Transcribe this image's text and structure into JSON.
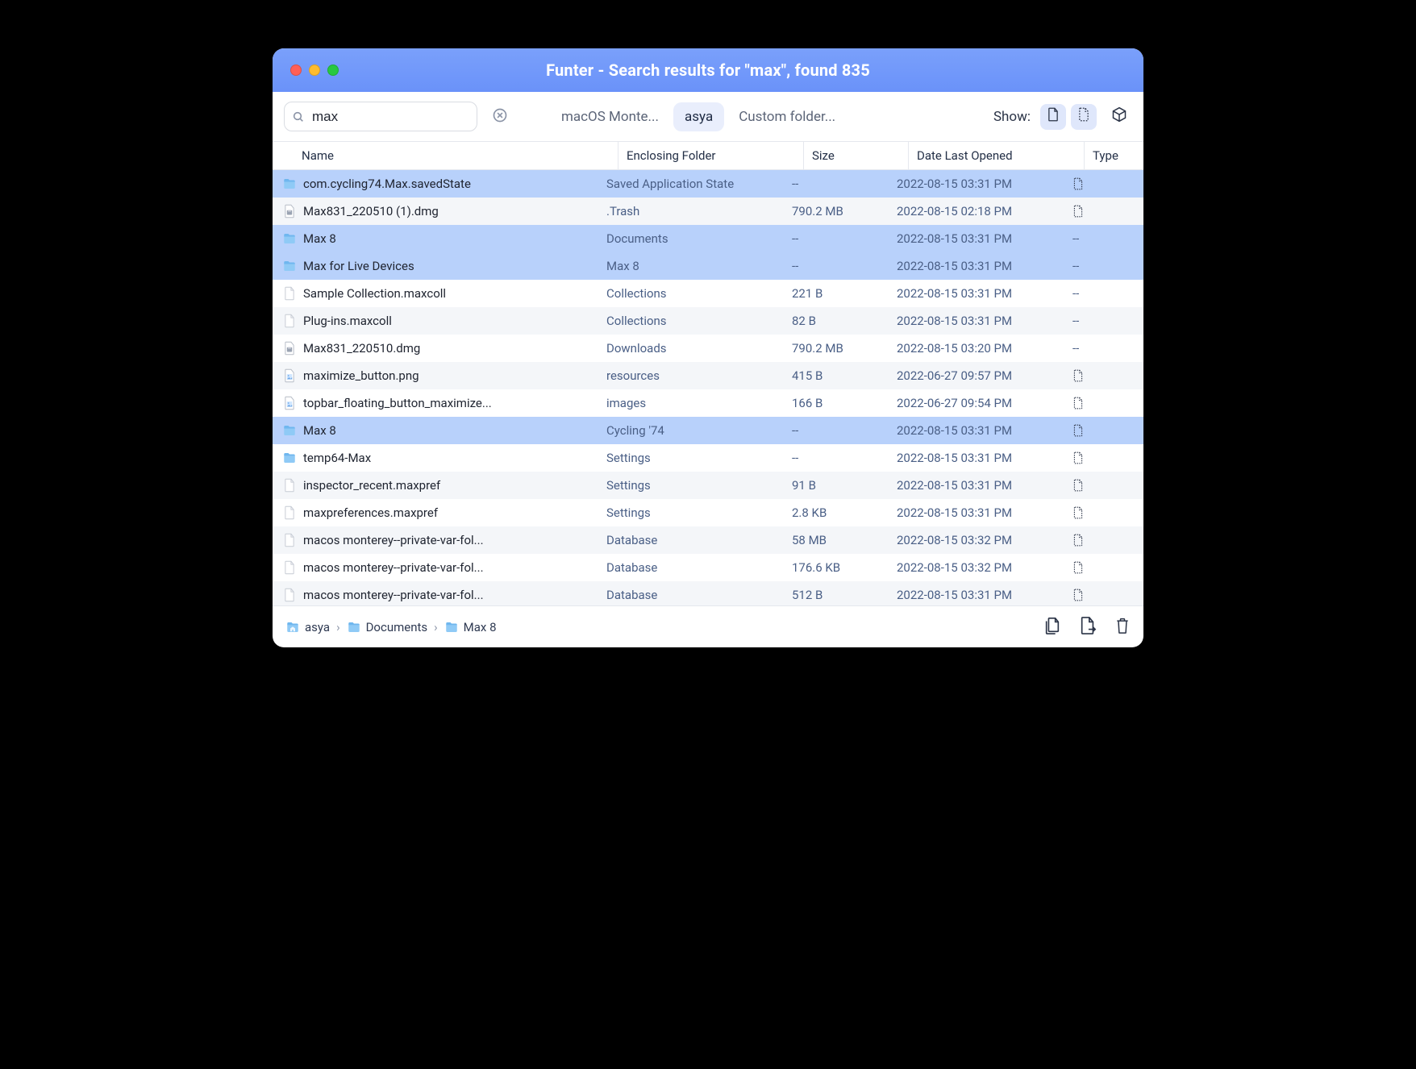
{
  "window": {
    "title": "Funter - Search results for \"max\", found 835"
  },
  "search": {
    "value": "max"
  },
  "scopes": {
    "items": [
      {
        "label": "macOS Monte...",
        "active": false
      },
      {
        "label": "asya",
        "active": true
      },
      {
        "label": "Custom folder...",
        "active": false
      }
    ]
  },
  "show": {
    "label": "Show:",
    "visible_files_on": true,
    "hidden_files_on": true
  },
  "columns": {
    "name": "Name",
    "folder": "Enclosing Folder",
    "size": "Size",
    "date": "Date Last Opened",
    "type": "Type"
  },
  "rows": [
    {
      "icon": "folder",
      "name": "com.cycling74.Max.savedState",
      "folder": "Saved Application State",
      "size": "--",
      "date": "2022-08-15 03:31 PM",
      "type": "hidden",
      "selected": true
    },
    {
      "icon": "dmg",
      "name": "Max831_220510 (1).dmg",
      "folder": ".Trash",
      "size": "790.2 MB",
      "date": "2022-08-15 02:18 PM",
      "type": "hidden",
      "selected": false
    },
    {
      "icon": "folder",
      "name": "Max 8",
      "folder": "Documents",
      "size": "--",
      "date": "2022-08-15 03:31 PM",
      "type": "--",
      "selected": true
    },
    {
      "icon": "folder",
      "name": "Max for Live Devices",
      "folder": "Max 8",
      "size": "--",
      "date": "2022-08-15 03:31 PM",
      "type": "--",
      "selected": true
    },
    {
      "icon": "file",
      "name": "Sample Collection.maxcoll",
      "folder": "Collections",
      "size": "221 B",
      "date": "2022-08-15 03:31 PM",
      "type": "--",
      "selected": false
    },
    {
      "icon": "file",
      "name": "Plug-ins.maxcoll",
      "folder": "Collections",
      "size": "82 B",
      "date": "2022-08-15 03:31 PM",
      "type": "--",
      "selected": false
    },
    {
      "icon": "dmg",
      "name": "Max831_220510.dmg",
      "folder": "Downloads",
      "size": "790.2 MB",
      "date": "2022-08-15 03:20 PM",
      "type": "--",
      "selected": false
    },
    {
      "icon": "image",
      "name": "maximize_button.png",
      "folder": "resources",
      "size": "415 B",
      "date": "2022-06-27 09:57 PM",
      "type": "hidden",
      "selected": false
    },
    {
      "icon": "image",
      "name": "topbar_floating_button_maximize...",
      "folder": "images",
      "size": "166 B",
      "date": "2022-06-27 09:54 PM",
      "type": "hidden",
      "selected": false
    },
    {
      "icon": "folder",
      "name": "Max 8",
      "folder": "Cycling '74",
      "size": "--",
      "date": "2022-08-15 03:31 PM",
      "type": "hidden",
      "selected": true
    },
    {
      "icon": "folder",
      "name": "temp64-Max",
      "folder": "Settings",
      "size": "--",
      "date": "2022-08-15 03:31 PM",
      "type": "hidden",
      "selected": false
    },
    {
      "icon": "file",
      "name": "inspector_recent.maxpref",
      "folder": "Settings",
      "size": "91 B",
      "date": "2022-08-15 03:31 PM",
      "type": "hidden",
      "selected": false
    },
    {
      "icon": "file",
      "name": "maxpreferences.maxpref",
      "folder": "Settings",
      "size": "2.8 KB",
      "date": "2022-08-15 03:31 PM",
      "type": "hidden",
      "selected": false
    },
    {
      "icon": "file",
      "name": "macos monterey--private-var-fol...",
      "folder": "Database",
      "size": "58 MB",
      "date": "2022-08-15 03:32 PM",
      "type": "hidden",
      "selected": false
    },
    {
      "icon": "file",
      "name": "macos monterey--private-var-fol...",
      "folder": "Database",
      "size": "176.6 KB",
      "date": "2022-08-15 03:32 PM",
      "type": "hidden",
      "selected": false
    },
    {
      "icon": "file",
      "name": "macos monterey--private-var-fol...",
      "folder": "Database",
      "size": "512 B",
      "date": "2022-08-15 03:31 PM",
      "type": "hidden",
      "selected": false
    }
  ],
  "path": {
    "segments": [
      {
        "icon": "home-folder",
        "label": "asya"
      },
      {
        "icon": "folder",
        "label": "Documents"
      },
      {
        "icon": "folder",
        "label": "Max 8"
      }
    ]
  }
}
